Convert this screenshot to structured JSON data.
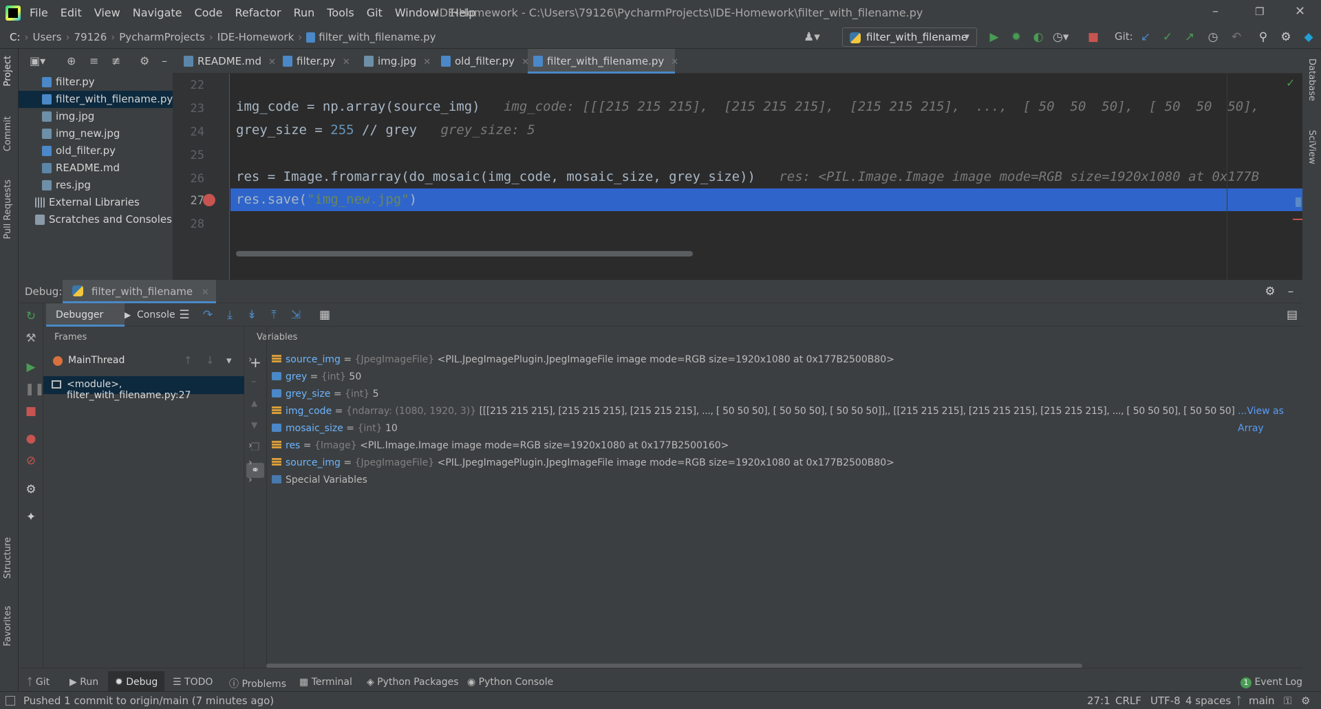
{
  "menu": [
    "File",
    "Edit",
    "View",
    "Navigate",
    "Code",
    "Refactor",
    "Run",
    "Tools",
    "Git",
    "Window",
    "Help"
  ],
  "window_title": "IDE-Homework - C:\\Users\\79126\\PycharmProjects\\IDE-Homework\\filter_with_filename.py",
  "breadcrumb": [
    "C:",
    "Users",
    "79126",
    "PycharmProjects",
    "IDE-Homework",
    "filter_with_filename.py"
  ],
  "run_config": "filter_with_filename",
  "git_label": "Git:",
  "project_files": [
    {
      "name": "filter.py",
      "type": "py"
    },
    {
      "name": "filter_with_filename.py",
      "type": "py"
    },
    {
      "name": "img.jpg",
      "type": "img"
    },
    {
      "name": "img_new.jpg",
      "type": "img"
    },
    {
      "name": "old_filter.py",
      "type": "py"
    },
    {
      "name": "README.md",
      "type": "md"
    },
    {
      "name": "res.jpg",
      "type": "img"
    },
    {
      "name": "External Libraries",
      "type": "lib"
    },
    {
      "name": "Scratches and Consoles",
      "type": "scratch"
    }
  ],
  "tabs": [
    "README.md",
    "filter.py",
    "img.jpg",
    "old_filter.py",
    "filter_with_filename.py"
  ],
  "active_tab": 4,
  "editor": {
    "line_numbers": [
      "22",
      "23",
      "24",
      "25",
      "26",
      "27",
      "28"
    ],
    "line23_code": "img_code = np.array(source_img)",
    "line23_hint": "img_code: [[[215 215 215],  [215 215 215],  [215 215 215],  ...,  [ 50  50  50],  [ 50  50  50],",
    "line24_a": "grey_size = ",
    "line24_num": "255",
    "line24_b": " // grey",
    "line24_hint": "grey_size: 5",
    "line26_code": "res = Image.fromarray(do_mosaic(img_code, mosaic_size, grey_size))",
    "line26_hint": "res: <PIL.Image.Image image mode=RGB size=1920x1080 at 0x177B",
    "line27_a": "res.save(",
    "line27_str": "\"img_new.jpg\"",
    "line27_b": ")"
  },
  "debug": {
    "label": "Debug:",
    "session": "filter_with_filename",
    "tab_debugger": "Debugger",
    "tab_console": "Console",
    "frames_title": "Frames",
    "variables_title": "Variables",
    "thread": "MainThread",
    "frame": "<module>, filter_with_filename.py:27",
    "variables": [
      {
        "name": "source_img",
        "type": "{JpegImageFile}",
        "value": "<PIL.JpegImagePlugin.JpegImageFile image mode=RGB size=1920x1080 at 0x177B2500B80>",
        "expandable": true,
        "icon": "obj"
      },
      {
        "name": "grey",
        "type": "{int}",
        "value": "50",
        "expandable": false,
        "icon": "int"
      },
      {
        "name": "grey_size",
        "type": "{int}",
        "value": "5",
        "expandable": false,
        "icon": "int"
      },
      {
        "name": "img_code",
        "type": "{ndarray: (1080, 1920, 3)}",
        "value": "[[[215 215 215],  [215 215 215],  [215 215 215],  ...,  [ 50  50  50],  [ 50  50  50],  [ 50  50  50]],, [[215 215 215],  [215 215 215],  [215 215 215],  ...,  [ 50  50  50],  [ 50  50  50],",
        "expandable": true,
        "icon": "obj",
        "link": "...View as Array"
      },
      {
        "name": "mosaic_size",
        "type": "{int}",
        "value": "10",
        "expandable": false,
        "icon": "int"
      },
      {
        "name": "res",
        "type": "{Image}",
        "value": "<PIL.Image.Image image mode=RGB size=1920x1080 at 0x177B2500160>",
        "expandable": true,
        "icon": "obj"
      },
      {
        "name": "source_img",
        "type": "{JpegImageFile}",
        "value": "<PIL.JpegImagePlugin.JpegImageFile image mode=RGB size=1920x1080 at 0x177B2500B80>",
        "expandable": true,
        "icon": "obj"
      },
      {
        "name": "Special Variables",
        "type": "",
        "value": "",
        "expandable": true,
        "icon": "spec"
      }
    ]
  },
  "left_strip": [
    "Project",
    "Commit",
    "Pull Requests",
    "Structure",
    "Favorites"
  ],
  "right_strip": [
    "Database",
    "SciView"
  ],
  "bottom_tabs": [
    "Git",
    "Run",
    "Debug",
    "TODO",
    "Problems",
    "Terminal",
    "Python Packages",
    "Python Console"
  ],
  "event_log": "Event Log",
  "event_count": "1",
  "status": {
    "message": "Pushed 1 commit to origin/main (7 minutes ago)",
    "position": "27:1",
    "line_sep": "CRLF",
    "encoding": "UTF-8",
    "indent": "4 spaces",
    "branch": "main"
  }
}
